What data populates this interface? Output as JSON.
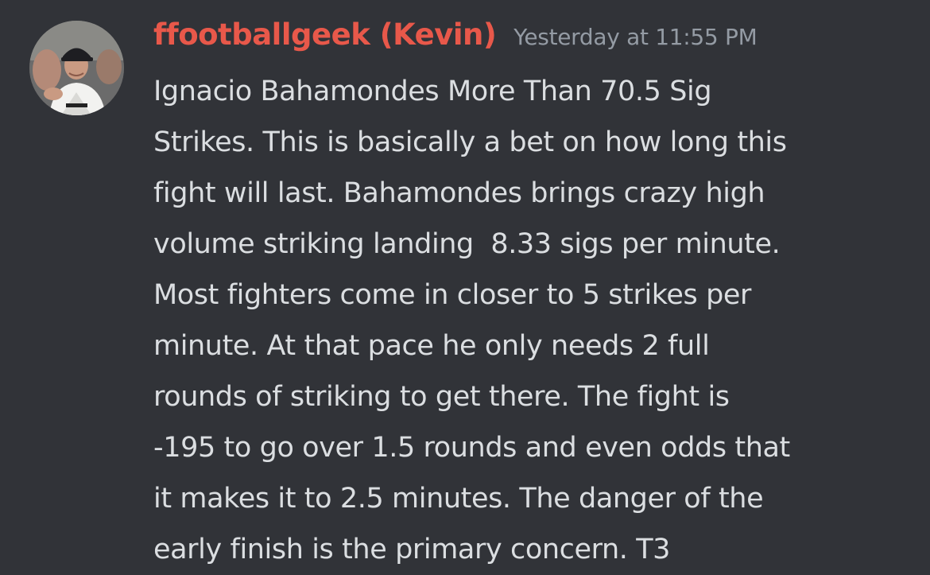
{
  "message": {
    "author": "ffootballgeek (Kevin)",
    "timestamp": "Yesterday at 11:55 PM",
    "avatar_icon": "user-avatar-photo",
    "author_color": "#e8584a",
    "lines": [
      "Ignacio Bahamondes More Than 70.5 Sig",
      "Strikes. This is basically a bet on how long this",
      "fight will last. Bahamondes brings crazy high",
      "volume striking landing  8.33 sigs per minute.",
      "Most fighters come in closer to 5 strikes per",
      "minute. At that pace he only needs 2 full",
      "rounds of striking to get there. The fight is",
      "-195 to go over 1.5 rounds and even odds that",
      "it makes it to 2.5 minutes. The danger of the",
      "early finish is the primary concern. T3"
    ]
  }
}
